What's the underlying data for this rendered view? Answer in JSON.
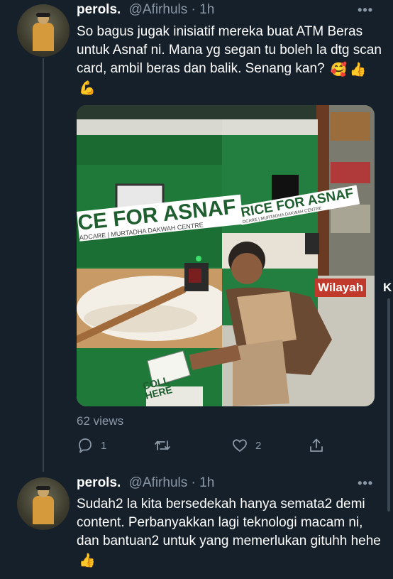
{
  "tweets": [
    {
      "display_name": "perols.",
      "handle": "@Afirhuls",
      "time": "1h",
      "text": "So bagus jugak inisiatif mereka buat ATM Beras untuk Asnaf ni. Mana yg segan tu boleh la dtg scan card, ambil beras dan balik. Senang kan?",
      "emojis": [
        "🥰",
        "👍",
        "💪"
      ],
      "media": {
        "sign_left": "CE FOR ASNAF",
        "sub_left": "ADCARE | MURTADHA DAKWAH CENTRE",
        "sign_right": "RICE FOR ASNAF",
        "sub_right": "DCARE | MURTADHA DAKWAH CENTRE",
        "collect_label": "COLL\nHERE",
        "watermark": "Wilayah",
        "watermark_tail": "K"
      },
      "views": "62 views",
      "reply_count": "1",
      "retweet_count": "",
      "like_count": "2"
    },
    {
      "display_name": "perols.",
      "handle": "@Afirhuls",
      "time": "1h",
      "text": "Sudah2 la kita bersedekah hanya semata2 demi content. Perbanyakkan lagi teknologi macam ni, dan bantuan2 untuk yang memerlukan gituhh hehe",
      "emojis": [
        "👍"
      ]
    }
  ],
  "colors": {
    "background": "#15202b",
    "muted_text": "#8b98a5",
    "thread_line": "#38444d",
    "watermark_bg": "#c0392b"
  },
  "icons": [
    "reply-icon",
    "retweet-icon",
    "like-icon",
    "share-icon",
    "more-icon"
  ],
  "ui": {
    "separator": "·",
    "more_glyph": "•••"
  }
}
